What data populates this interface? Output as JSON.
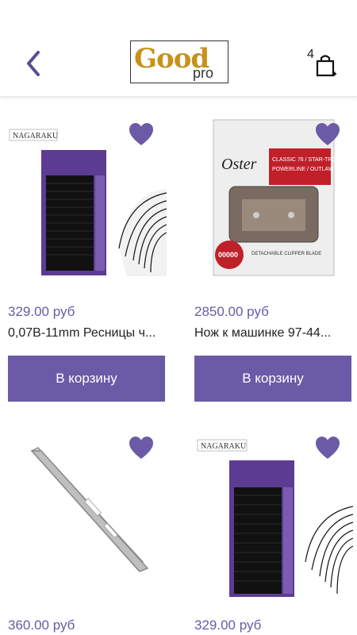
{
  "header": {
    "logo_main": "Good",
    "logo_sub": "pro",
    "cart_count": "4"
  },
  "colors": {
    "accent": "#6b5aa6",
    "logo_gold": "#c8921a"
  },
  "products": [
    {
      "price": "329.00 руб",
      "title": "0,07В-11mm Ресницы ч...",
      "button": "В корзину",
      "brand_label": "NAGARAKU",
      "image": "lash-box"
    },
    {
      "price": "2850.00 руб",
      "title": "Нож к машинке 97-44...",
      "button": "В корзину",
      "brand_label": "Oster",
      "image": "clipper-blade"
    },
    {
      "price": "360.00 руб",
      "title": "",
      "button": "",
      "image": "tweezers"
    },
    {
      "price": "329.00 руб",
      "title": "",
      "button": "",
      "brand_label": "NAGARAKU",
      "image": "lash-box"
    }
  ]
}
